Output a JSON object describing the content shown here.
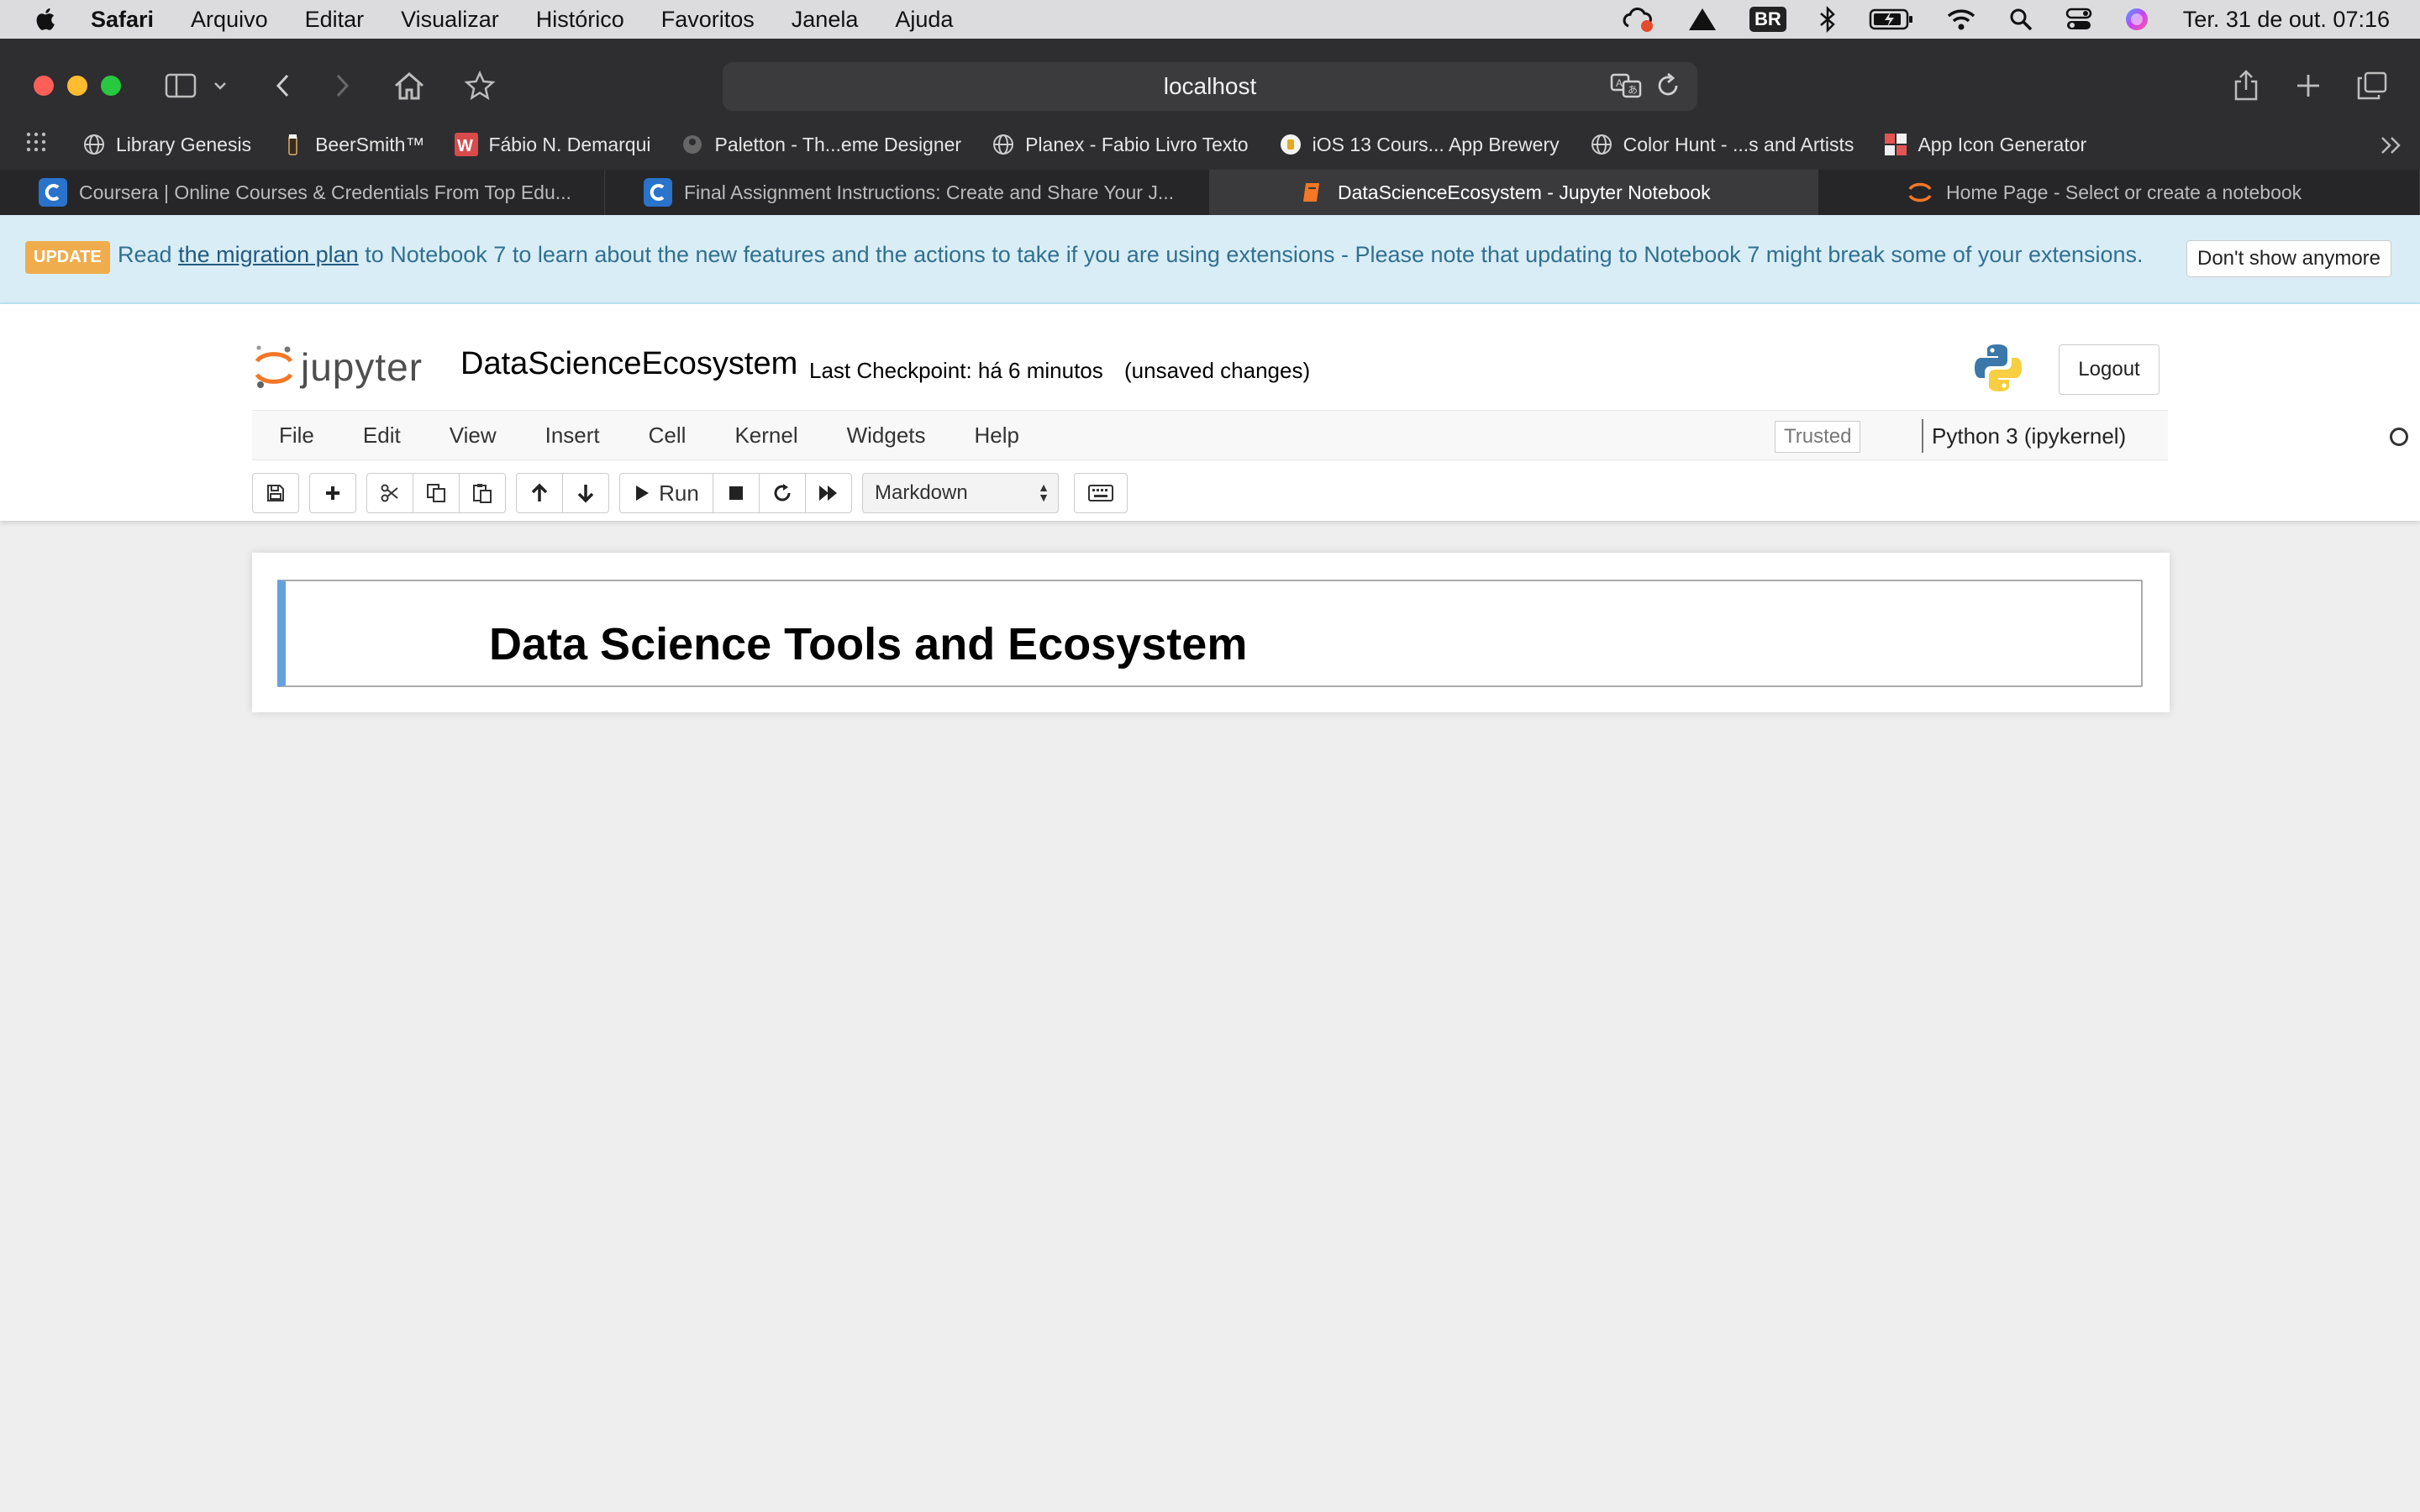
{
  "menubar": {
    "app": "Safari",
    "items": [
      "Arquivo",
      "Editar",
      "Visualizar",
      "Histórico",
      "Favoritos",
      "Janela",
      "Ajuda"
    ],
    "input_badge": "BR",
    "clock": "Ter. 31 de out.  07:16"
  },
  "browser": {
    "address": "localhost",
    "bookmarks": [
      {
        "label": "Library Genesis",
        "icon": "globe-icon"
      },
      {
        "label": "BeerSmith™",
        "icon": "beer-icon"
      },
      {
        "label": "Fábio N. Demarqui",
        "icon": "w-icon"
      },
      {
        "label": "Paletton - Th...eme Designer",
        "icon": "palette-icon"
      },
      {
        "label": "Planex - Fabio Livro Texto",
        "icon": "globe-icon"
      },
      {
        "label": "iOS 13 Cours... App Brewery",
        "icon": "brewery-icon"
      },
      {
        "label": "Color Hunt - ...s and Artists",
        "icon": "globe-icon"
      },
      {
        "label": "App Icon Generator",
        "icon": "grid-icon"
      }
    ],
    "tabs": [
      {
        "label": "Coursera | Online Courses & Credentials From Top Edu...",
        "icon": "coursera-icon",
        "active": false
      },
      {
        "label": "Final Assignment Instructions: Create and Share Your J...",
        "icon": "coursera-icon",
        "active": false
      },
      {
        "label": "DataScienceEcosystem - Jupyter Notebook",
        "icon": "notebook-icon",
        "active": true
      },
      {
        "label": "Home Page - Select or create a notebook",
        "icon": "jupyter-icon",
        "active": false
      }
    ]
  },
  "banner": {
    "badge": "UPDATE",
    "prefix": "Read ",
    "link": "the migration plan",
    "suffix": " to Notebook 7 to learn about the new features and the actions to take if you are using extensions - Please note that updating to Notebook 7 might break some of your extensions.",
    "dismiss": "Don't show anymore"
  },
  "jupyter": {
    "wordmark": "jupyter",
    "notebook_name": "DataScienceEcosystem",
    "checkpoint": "Last Checkpoint: há 6 minutos",
    "unsaved": "(unsaved changes)",
    "logout": "Logout",
    "menu": [
      "File",
      "Edit",
      "View",
      "Insert",
      "Cell",
      "Kernel",
      "Widgets",
      "Help"
    ],
    "trusted": "Trusted",
    "kernel": "Python 3 (ipykernel)",
    "run_label": "Run",
    "cell_type": "Markdown"
  },
  "notebook": {
    "cell_heading": "Data Science Tools and Ecosystem"
  },
  "colors": {
    "banner_bg": "#d9edf7",
    "badge": "#f0ad4e",
    "cell_selected_border": "#66a1dd",
    "jupyter_orange": "#f37726"
  }
}
